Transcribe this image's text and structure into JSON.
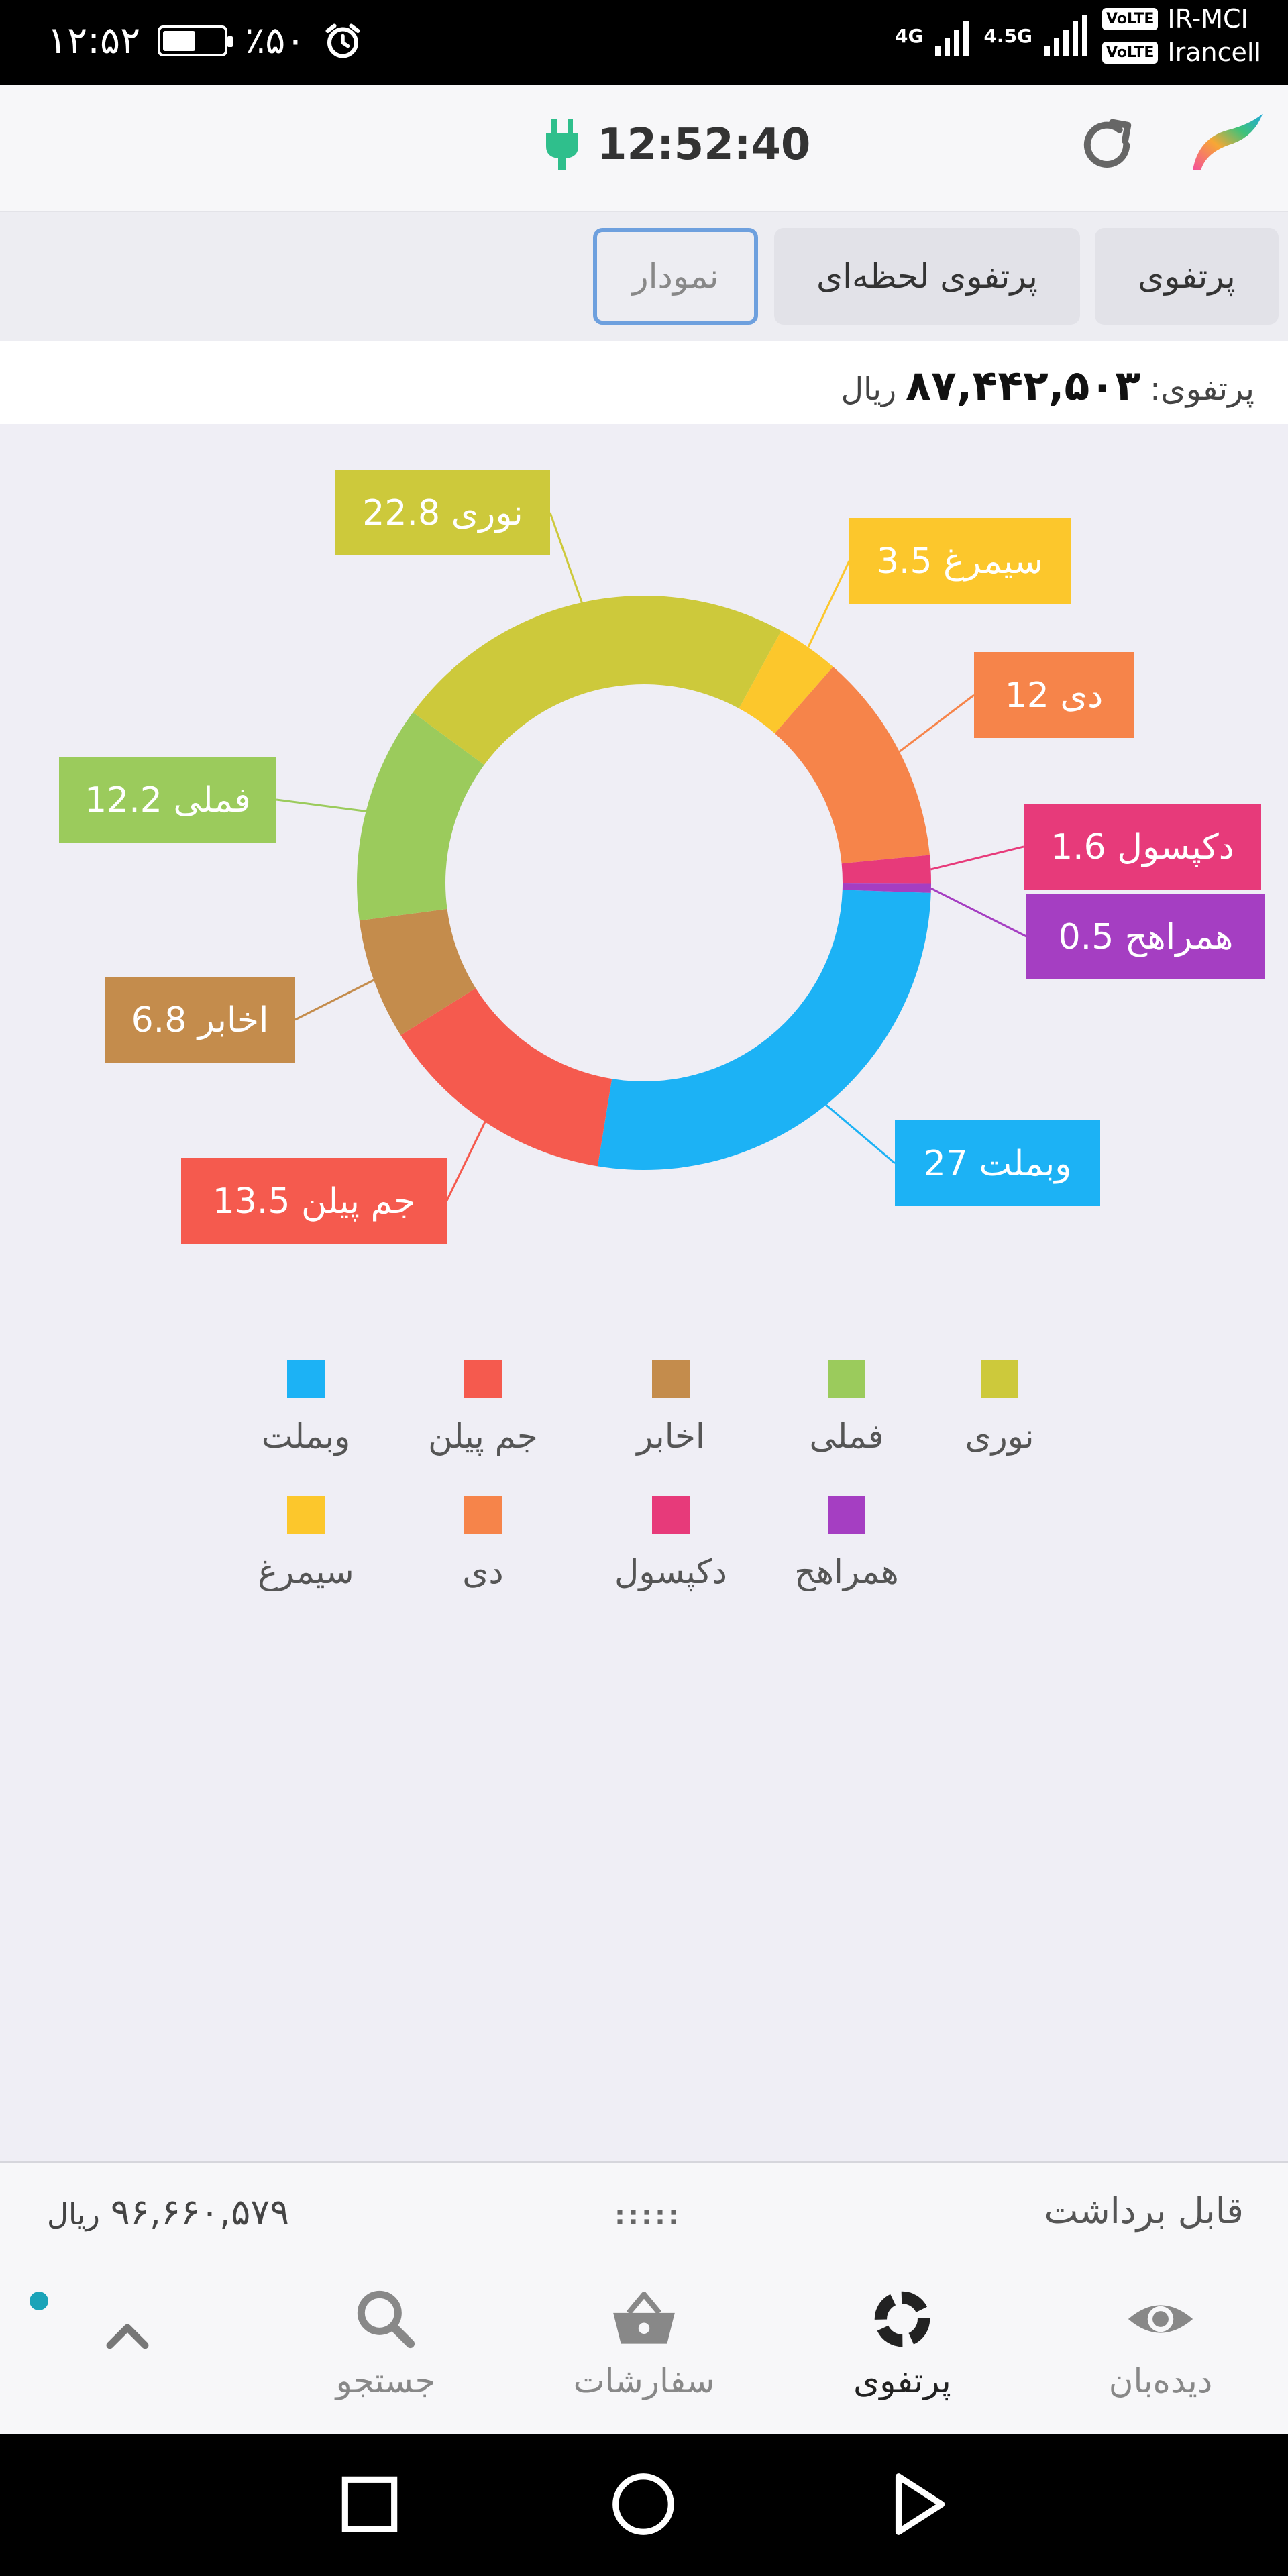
{
  "status_bar": {
    "time": "۱۲:۵۲",
    "battery": "٪۵۰",
    "carrier_1": "IR-MCI",
    "carrier_2": "Irancell",
    "network_1": "4G",
    "network_2": "4.5G",
    "volte": "VoLTE"
  },
  "header": {
    "clock": "12:52:40"
  },
  "tabs": [
    {
      "label": "پرتفوی"
    },
    {
      "label": "پرتفوی لحظه‌ای"
    },
    {
      "label": "نمودار",
      "active": true
    }
  ],
  "portfolio": {
    "label": "پرتفوی:",
    "value": "۸۷,۴۴۲,۵۰۳",
    "unit": "ریال"
  },
  "chart_data": {
    "type": "pie",
    "donut": true,
    "labels": [
      "وبملت",
      "جم پیلن",
      "اخابر",
      "فملی",
      "نوری",
      "سیمرغ",
      "دی",
      "دکپسول",
      "همراهح"
    ],
    "values": [
      27,
      13.5,
      6.8,
      12.2,
      22.8,
      3.5,
      12,
      1.6,
      0.5
    ],
    "colors": [
      "#1cb2f5",
      "#f55a4e",
      "#c48c4c",
      "#9bcb5c",
      "#cdc93b",
      "#fcc72c",
      "#f6844a",
      "#e73a7a",
      "#a53ec2"
    ],
    "legend": "bottom"
  },
  "withdrawable": {
    "label": "قابل برداشت",
    "dots": ":::::",
    "value": "۹۶,۶۶۰,۵۷۹",
    "unit": "ریال"
  },
  "bottom_nav": {
    "watch": "دیده‌بان",
    "portfolio": "پرتفوی",
    "orders": "سفارشات",
    "search": "جستجو"
  }
}
